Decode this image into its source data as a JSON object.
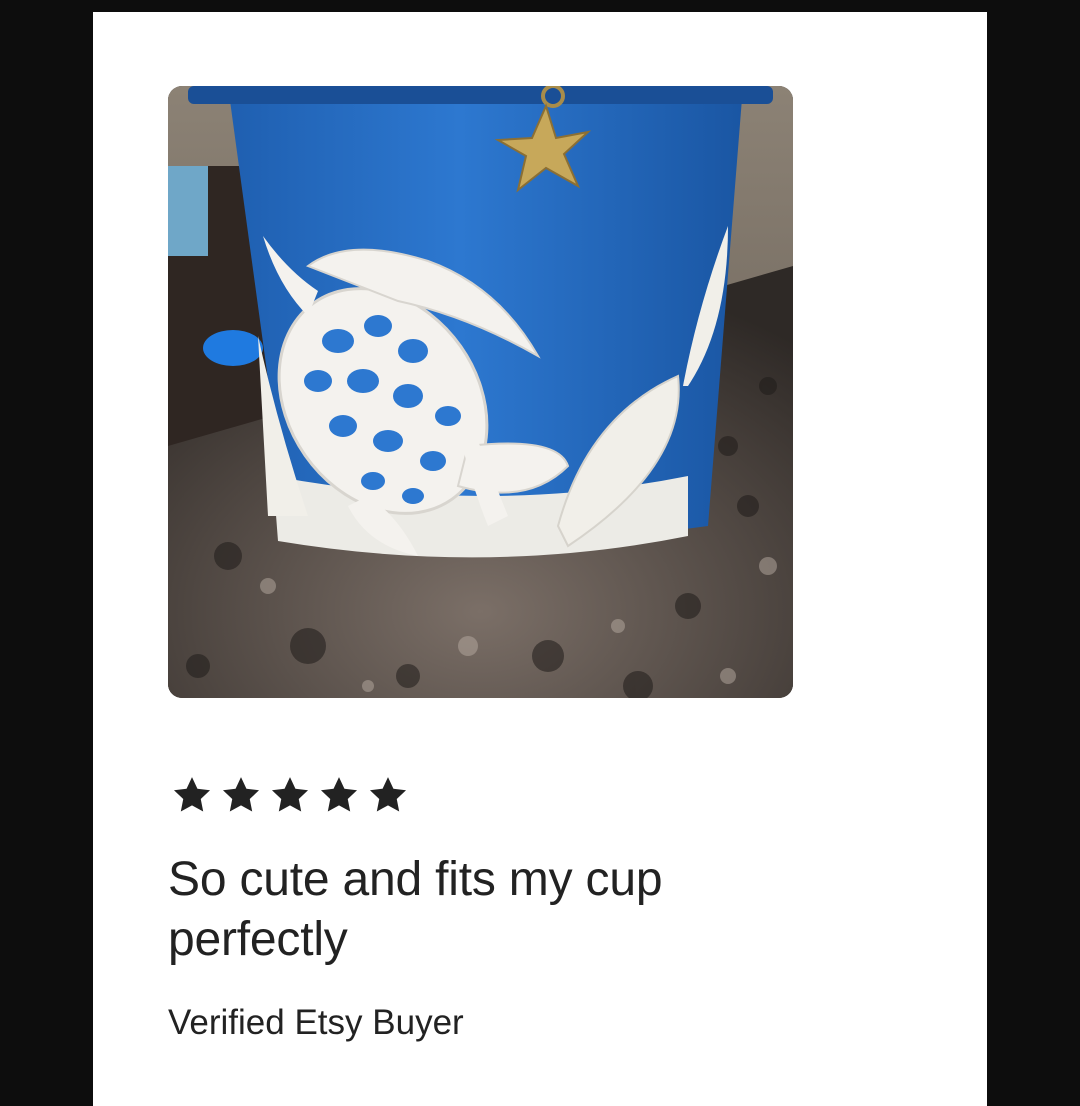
{
  "review": {
    "rating": 5,
    "rating_max": 5,
    "title": "So cute and fits my cup perfectly",
    "reviewer": "Verified Etsy Buyer"
  },
  "photo": {
    "subject": "blue cup with white sea-turtle sleeve and gold starfish charm"
  },
  "icons": {
    "star": "star-icon"
  },
  "colors": {
    "star": "#222222",
    "text": "#222222",
    "background": "#0d0d0d",
    "card": "#ffffff"
  }
}
